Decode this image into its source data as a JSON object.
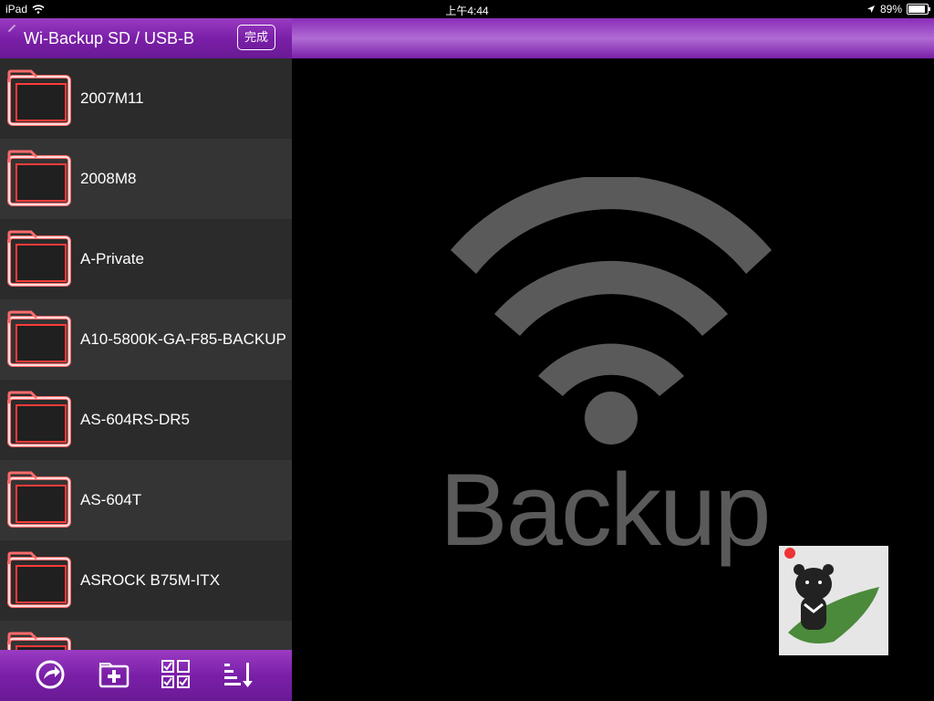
{
  "status_bar": {
    "device": "iPad",
    "time": "上午4:44",
    "battery_text": "89%",
    "battery_level": 0.89
  },
  "sidebar": {
    "title": "Wi-Backup SD / USB-B",
    "done_label": "完成",
    "files": [
      {
        "name": "2007M11"
      },
      {
        "name": "2008M8"
      },
      {
        "name": "A-Private"
      },
      {
        "name": "A10-5800K-GA-F85-BACKUP"
      },
      {
        "name": "AS-604RS-DR5"
      },
      {
        "name": "AS-604T"
      },
      {
        "name": "ASROCK B75M-ITX"
      },
      {
        "name": ""
      }
    ],
    "toolbar_icons": [
      "share-icon",
      "new-folder-icon",
      "multi-select-icon",
      "sort-icon"
    ]
  },
  "content": {
    "logo_text": "Backup"
  },
  "colors": {
    "accent": "#7a1fa8",
    "folder_stroke": "#ff3b3b",
    "logo_gray": "#5a5a5a"
  }
}
